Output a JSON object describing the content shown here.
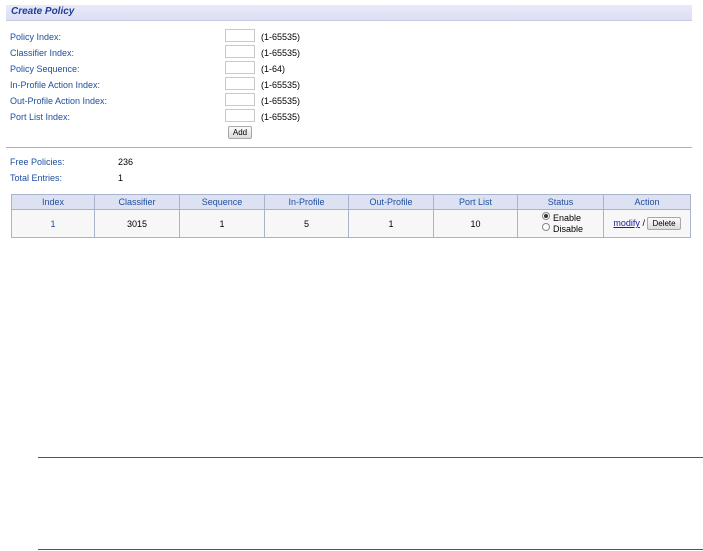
{
  "header": {
    "title": "Create Policy"
  },
  "form": {
    "fields": [
      {
        "label": "Policy Index:",
        "value": "",
        "range": "(1-65535)"
      },
      {
        "label": "Classifier Index:",
        "value": "",
        "range": "(1-65535)"
      },
      {
        "label": "Policy Sequence:",
        "value": "",
        "range": "(1-64)"
      },
      {
        "label": "In-Profile Action Index:",
        "value": "",
        "range": "(1-65535)"
      },
      {
        "label": "Out-Profile Action Index:",
        "value": "",
        "range": "(1-65535)"
      },
      {
        "label": "Port List Index:",
        "value": "",
        "range": "(1-65535)"
      }
    ],
    "add_label": "Add"
  },
  "summary": {
    "free_label": "Free Policies:",
    "free_value": "236",
    "total_label": "Total Entries:",
    "total_value": "1"
  },
  "table": {
    "headers": [
      "Index",
      "Classifier",
      "Sequence",
      "In-Profile",
      "Out-Profile",
      "Port List",
      "Status",
      "Action"
    ],
    "rows": [
      {
        "index": "1",
        "classifier": "3015",
        "sequence": "1",
        "in_profile": "5",
        "out_profile": "1",
        "port_list": "10",
        "status_enable": "Enable",
        "status_disable": "Disable",
        "status_selected": "Enable",
        "modify": "modify",
        "action_sep": "/",
        "delete": "Delete"
      }
    ]
  }
}
